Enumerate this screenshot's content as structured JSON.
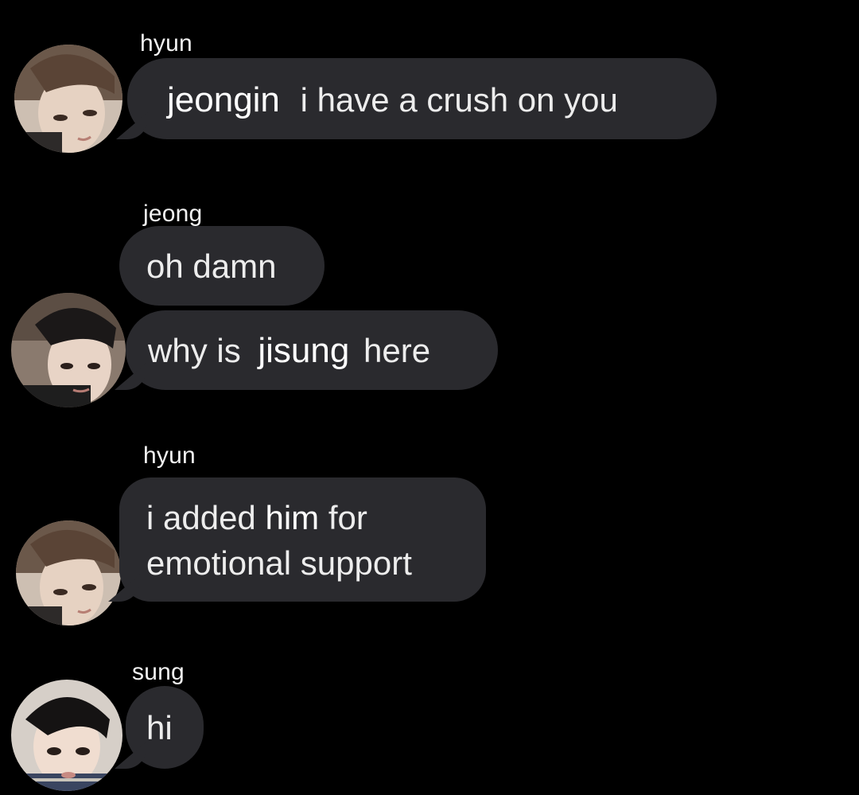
{
  "messages": [
    {
      "sender": "hyun",
      "avatar_icon": "user-avatar-hyun",
      "bubbles": [
        {
          "mention": "jeongin",
          "text": "i have a crush on you"
        }
      ]
    },
    {
      "sender": "jeong",
      "avatar_icon": "user-avatar-jeong",
      "bubbles": [
        {
          "text": "oh damn"
        },
        {
          "text_before": "why is",
          "mention": "jisung",
          "text_after": "here"
        }
      ]
    },
    {
      "sender": "hyun",
      "avatar_icon": "user-avatar-hyun",
      "bubbles": [
        {
          "line1_before": "i added",
          "line1_emph": "him",
          "line1_after": "for",
          "line2": "emotional support"
        }
      ]
    },
    {
      "sender": "sung",
      "avatar_icon": "user-avatar-sung",
      "bubbles": [
        {
          "text": "hi"
        }
      ]
    }
  ],
  "colors": {
    "background": "#000000",
    "bubble": "#2a2a2e",
    "text": "#ededed"
  }
}
